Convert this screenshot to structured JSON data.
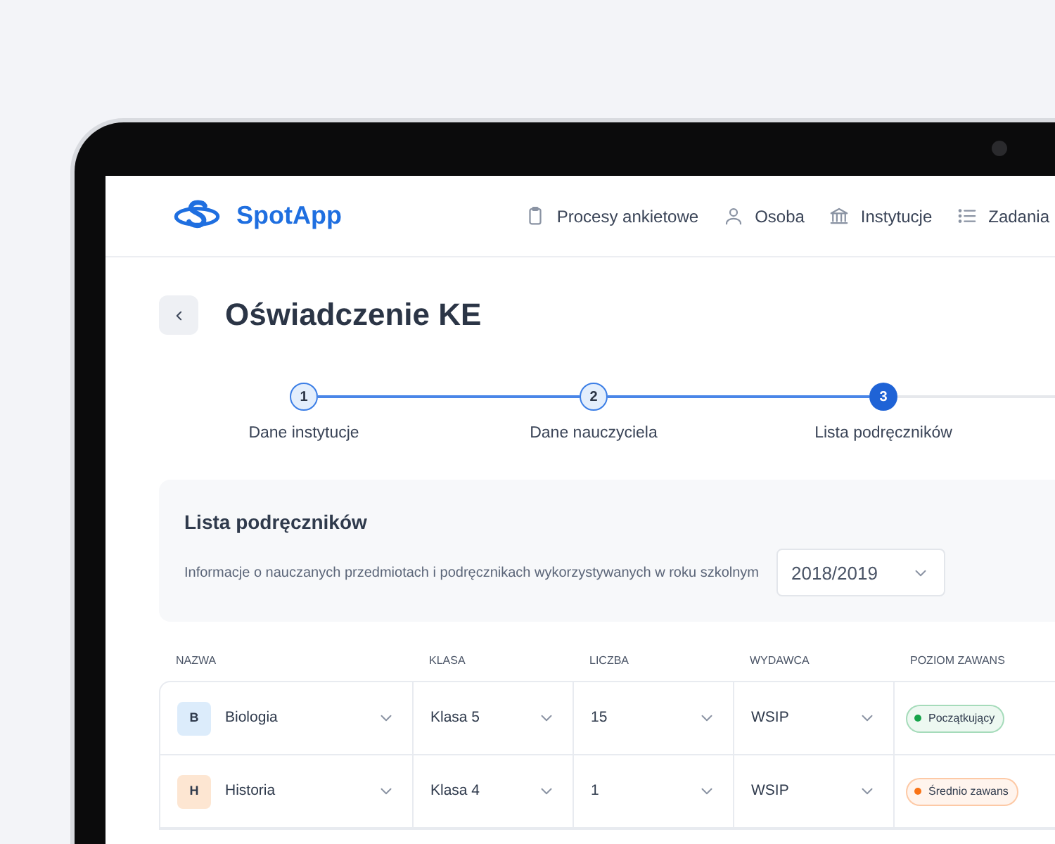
{
  "brand": "SpotApp",
  "nav": [
    {
      "label": "Procesy ankietowe"
    },
    {
      "label": "Osoba"
    },
    {
      "label": "Instytucje"
    },
    {
      "label": "Zadania"
    }
  ],
  "page_title": "Oświadczenie KE",
  "steps": [
    {
      "number": "1",
      "label": "Dane instytucje",
      "completed": true,
      "selected": false
    },
    {
      "number": "2",
      "label": "Dane nauczyciela",
      "completed": true,
      "selected": false
    },
    {
      "number": "3",
      "label": "Lista podręczników",
      "completed": false,
      "selected": true
    }
  ],
  "panel": {
    "title": "Lista podręczników",
    "description": "Informacje o nauczanych przedmiotach i podręcznikach wykorzystywanych w roku szkolnym",
    "year": "2018/2019"
  },
  "table": {
    "columns": [
      "NAZWA",
      "KLASA",
      "LICZBA",
      "WYDAWCA",
      "POZIOM ZAWANS"
    ],
    "rows": [
      {
        "initial": "B",
        "color": "#dcecfb",
        "subject": "Biologia",
        "class": "Klasa 5",
        "count": "15",
        "publisher": "WSIP",
        "level": {
          "text": "Początkujący",
          "color": "#16a34a"
        }
      },
      {
        "initial": "H",
        "color": "#fde6d2",
        "subject": "Historia",
        "class": "Klasa 4",
        "count": "1",
        "publisher": "WSIP",
        "level": {
          "text": "Średnio zawans",
          "color": "#f97316"
        }
      }
    ]
  }
}
